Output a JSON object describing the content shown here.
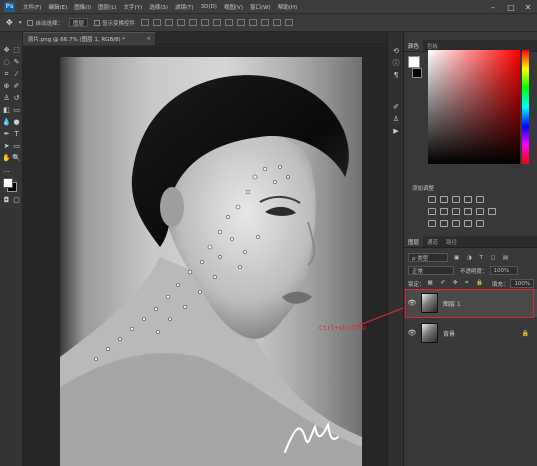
{
  "menubar": {
    "logo": "Ps",
    "items": [
      "文件(F)",
      "编辑(E)",
      "图像(I)",
      "图层(L)",
      "文字(Y)",
      "选择(S)",
      "滤镜(T)",
      "3D(D)",
      "视图(V)",
      "窗口(W)",
      "帮助(H)"
    ]
  },
  "options": {
    "auto_select": "自动选择：",
    "auto_select_value": "图层",
    "show_transform": "显示变换控件"
  },
  "document_tab": {
    "title": "原片.png @ 66.7% (图层 1, RGB/8) *",
    "close": "×"
  },
  "panels": {
    "color_tabs": [
      "颜色",
      "色板"
    ],
    "adjustments_label": "添加调整",
    "layers_tabs": [
      "图层",
      "通道",
      "路径"
    ],
    "filter_type": "ρ 类型",
    "blend_mode": "正常",
    "opacity_label": "不透明度：",
    "opacity_value": "100%",
    "lock_label": "锁定：",
    "fill_label": "填充：",
    "fill_value": "100%",
    "layers": [
      {
        "name": "图层 1"
      },
      {
        "name": "背景"
      }
    ]
  },
  "annotation": "Ctrl+shift+U",
  "colors": {
    "annotation": "#e0253a",
    "foreground": "#ffffff",
    "background": "#000000"
  }
}
